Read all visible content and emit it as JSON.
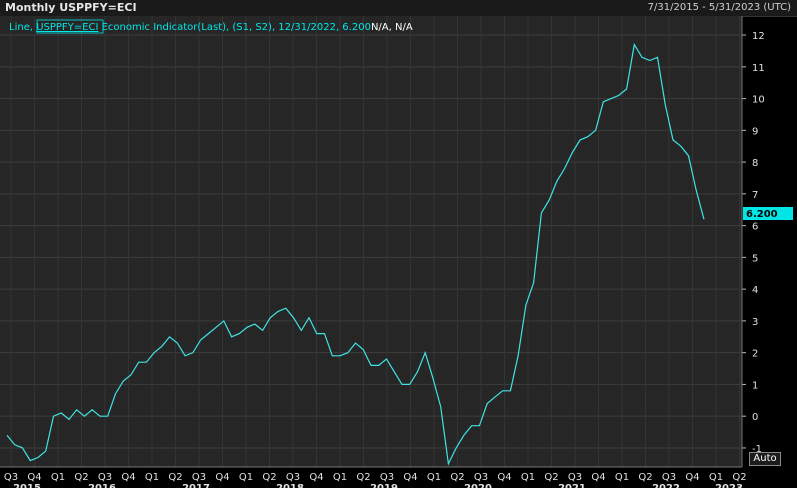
{
  "header": {
    "title": "Monthly USPPFY=ECI",
    "date_range": "7/31/2015 - 5/31/2023 (UTC)"
  },
  "legend": {
    "prefix": "Line, ",
    "ric": "USPPFY=ECI",
    "description": " Economic Indicator(Last), (S1, S2), 12/31/2022, 6.200",
    "tail": "N/A, N/A"
  },
  "auto_button": "Auto",
  "colors": {
    "line": "#3fe3e3",
    "background": "#262626",
    "grid": "#3d3d3d",
    "badge": "#00e5e5"
  },
  "chart_data": {
    "type": "line",
    "y_ticks": [
      -1,
      0,
      1,
      2,
      3,
      4,
      5,
      6,
      7,
      8,
      9,
      10,
      11,
      12
    ],
    "ylim": [
      -1.6,
      12.6
    ],
    "grid": true,
    "last_value_badge": "6.200",
    "x_quarter_labels": [
      "Q3",
      "Q4",
      "Q1",
      "Q2",
      "Q3",
      "Q4",
      "Q1",
      "Q2",
      "Q3",
      "Q4",
      "Q1",
      "Q2",
      "Q3",
      "Q4",
      "Q1",
      "Q2",
      "Q3",
      "Q4",
      "Q1",
      "Q2",
      "Q3",
      "Q4",
      "Q1",
      "Q2",
      "Q3",
      "Q4",
      "Q1",
      "Q2",
      "Q3",
      "Q4",
      "Q1",
      "Q2"
    ],
    "x_year_labels": [
      "2015",
      "2016",
      "2017",
      "2018",
      "2019",
      "2020",
      "2021",
      "2022",
      "2023"
    ],
    "series": [
      {
        "values": [
          -0.6,
          -0.9,
          -1.0,
          -1.4,
          -1.3,
          -1.1,
          0.0,
          0.1,
          -0.1,
          0.2,
          0.0,
          0.2,
          0.0,
          0.0,
          0.7,
          1.1,
          1.3,
          1.7,
          1.7,
          2.0,
          2.2,
          2.5,
          2.3,
          1.9,
          2.0,
          2.4,
          2.6,
          2.8,
          3.0,
          2.5,
          2.6,
          2.8,
          2.9,
          2.7,
          3.1,
          3.3,
          3.4,
          3.1,
          2.7,
          3.1,
          2.6,
          2.6,
          1.9,
          1.9,
          2.0,
          2.3,
          2.1,
          1.6,
          1.6,
          1.8,
          1.4,
          1.0,
          1.0,
          1.4,
          2.0,
          1.2,
          0.3,
          -1.5,
          -1.0,
          -0.6,
          -0.3,
          -0.3,
          0.4,
          0.6,
          0.8,
          0.8,
          1.9,
          3.5,
          4.2,
          6.4,
          6.8,
          7.4,
          7.8,
          8.3,
          8.7,
          8.8,
          9.0,
          9.9,
          10.0,
          10.1,
          10.3,
          11.7,
          11.3,
          11.2,
          11.3,
          9.8,
          8.7,
          8.5,
          8.2,
          7.1,
          6.2
        ]
      }
    ]
  }
}
